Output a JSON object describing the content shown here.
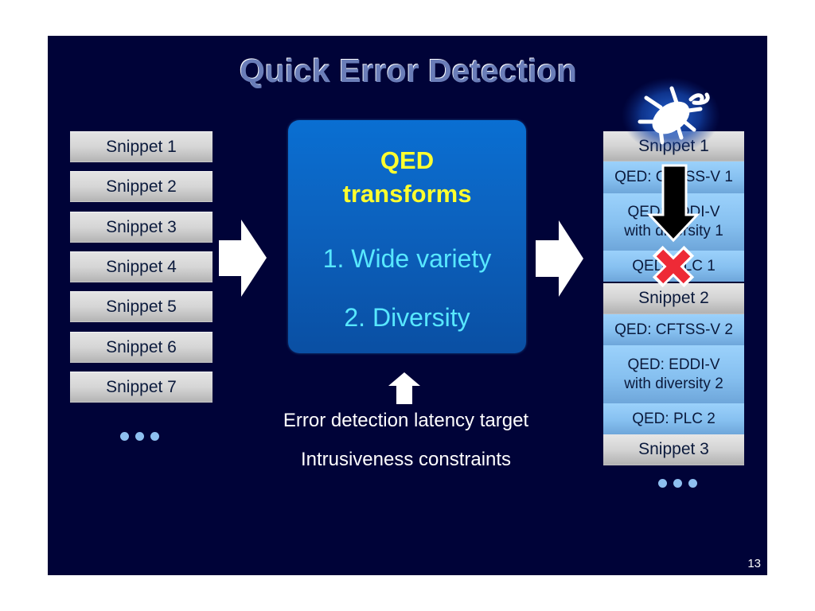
{
  "slide": {
    "title": "Quick Error Detection",
    "page_number": "13"
  },
  "left_column": {
    "snippets": [
      "Snippet 1",
      "Snippet 2",
      "Snippet 3",
      "Snippet 4",
      "Snippet 5",
      "Snippet 6",
      "Snippet 7"
    ],
    "ellipsis": "more-dots"
  },
  "center": {
    "box_title_line1": "QED",
    "box_title_line2": "transforms",
    "items": [
      "1. Wide variety",
      "2. Diversity"
    ],
    "inputs": [
      "Error detection latency target",
      "Intrusiveness constraints"
    ]
  },
  "right_column": {
    "blocks": [
      {
        "type": "snippet",
        "label": "Snippet 1"
      },
      {
        "type": "qed",
        "label": "QED: CFTSS-V 1"
      },
      {
        "type": "qed",
        "label": "QED: EDDI-V with diversity 1",
        "line1": "QED: EDDI-V",
        "line2": "with diversity 1"
      },
      {
        "type": "qed",
        "label": "QED: PLC 1"
      },
      {
        "type": "snippet",
        "label": "Snippet 2"
      },
      {
        "type": "qed",
        "label": "QED: CFTSS-V 2"
      },
      {
        "type": "qed",
        "label": "QED: EDDI-V with diversity 2",
        "line1": "QED: EDDI-V",
        "line2": "with diversity 2"
      },
      {
        "type": "qed",
        "label": "QED: PLC 2"
      },
      {
        "type": "snippet",
        "label": "Snippet 3"
      }
    ],
    "icons": [
      "bug-icon",
      "down-arrow-icon",
      "error-x-icon"
    ]
  },
  "colors": {
    "background": "#000338",
    "qed_title": "#ffff2e",
    "qed_items": "#58e8ff",
    "error_mark": "#ee2a36",
    "dots": "#8ec0f0"
  }
}
